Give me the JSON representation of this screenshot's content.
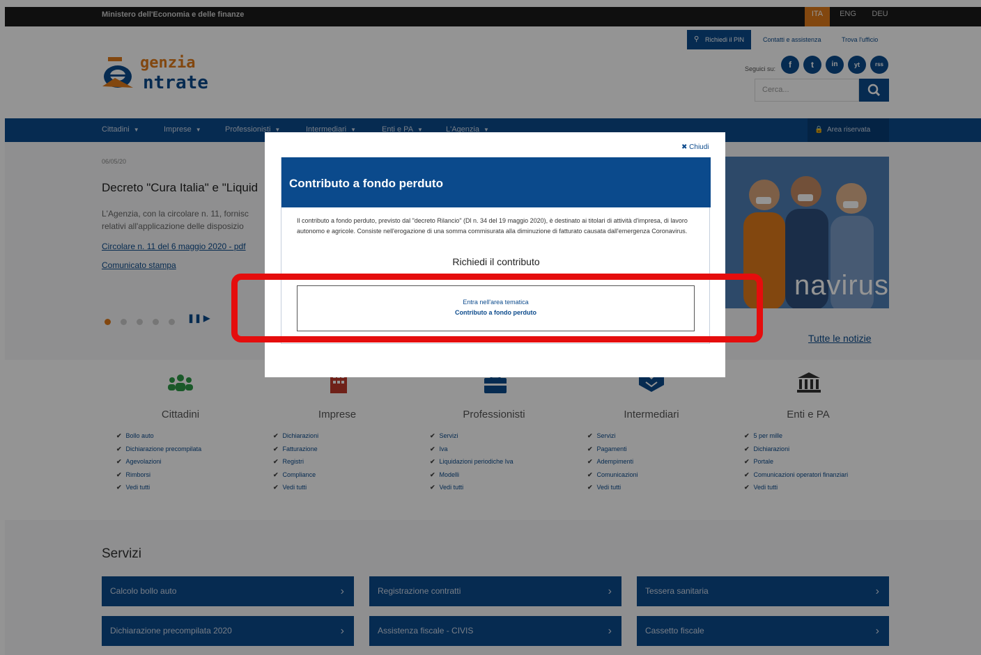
{
  "topbar": {
    "ministry": "Ministero dell'Economia e delle finanze",
    "languages": [
      "ITA",
      "ENG",
      "DEU"
    ],
    "active_language": "ITA"
  },
  "header": {
    "logo_text_1": "genzia",
    "logo_text_2": "ntrate",
    "pin_button": "Richiedi il PIN",
    "links": [
      "Contatti e assistenza",
      "Trova l'ufficio"
    ],
    "follow_label": "Seguici su:",
    "social": [
      "f",
      "t",
      "in",
      "yt",
      "rss"
    ],
    "search_placeholder": "Cerca..."
  },
  "nav": {
    "items": [
      "Cittadini",
      "Imprese",
      "Professionisti",
      "Intermediari",
      "Enti e PA",
      "L'Agenzia"
    ],
    "reserved_area": "Area riservata"
  },
  "news": {
    "date": "06/05/20",
    "title": "Decreto \"Cura Italia\" e \"Liquid",
    "body": [
      "L'Agenzia, con la circolare n. 11, fornisc",
      "relativi all'applicazione delle disposizio"
    ],
    "links": [
      "Circolare n. 11 del 6 maggio 2020 - pdf",
      "Comunicato stampa"
    ],
    "all_news": "Tutte le notizie",
    "hero_text": "navirus"
  },
  "categories": [
    {
      "title": "Cittadini",
      "items": [
        "Bollo auto",
        "Dichiarazione precompilata",
        "Agevolazioni",
        "Rimborsi",
        "Vedi tutti"
      ]
    },
    {
      "title": "Imprese",
      "items": [
        "Dichiarazioni",
        "Fatturazione",
        "Registri",
        "Compliance",
        "Vedi tutti"
      ]
    },
    {
      "title": "Professionisti",
      "items": [
        "Servizi",
        "Iva",
        "Liquidazioni periodiche Iva",
        "Modelli",
        "Vedi tutti"
      ]
    },
    {
      "title": "Intermediari",
      "items": [
        "Servizi",
        "Pagamenti",
        "Adempimenti",
        "Comunicazioni",
        "Vedi tutti"
      ]
    },
    {
      "title": "Enti e PA",
      "items": [
        "5 per mille",
        "Dichiarazioni",
        "Portale",
        "Comunicazioni operatori finanziari",
        "Vedi tutti"
      ]
    }
  ],
  "services": {
    "title": "Servizi",
    "items": [
      "Calcolo bollo auto",
      "Registrazione contratti",
      "Tessera sanitaria",
      "Dichiarazione precompilata 2020",
      "Assistenza fiscale - CIVIS",
      "Cassetto fiscale"
    ]
  },
  "modal": {
    "close_label": "Chiudi",
    "title": "Contributo a fondo perduto",
    "description": "Il contributo a fondo perduto, previsto dal \"decreto Rilancio\" (Dl n. 34 del 19 maggio 2020), è destinato ai titolari di attività d'impresa, di lavoro autonomo e agricole. Consiste nell'erogazione di una somma commisurata alla diminuzione di fatturato causata dall'emergenza Coronavirus.",
    "subtitle": "Richiedi il contributo",
    "box_line_1": "Entra nell'area tematica",
    "box_line_2": "Contributo a fondo perduto"
  },
  "colors": {
    "brand_blue": "#0b4a8c",
    "brand_orange": "#e07b1a",
    "highlight_red": "#e50d0d"
  }
}
